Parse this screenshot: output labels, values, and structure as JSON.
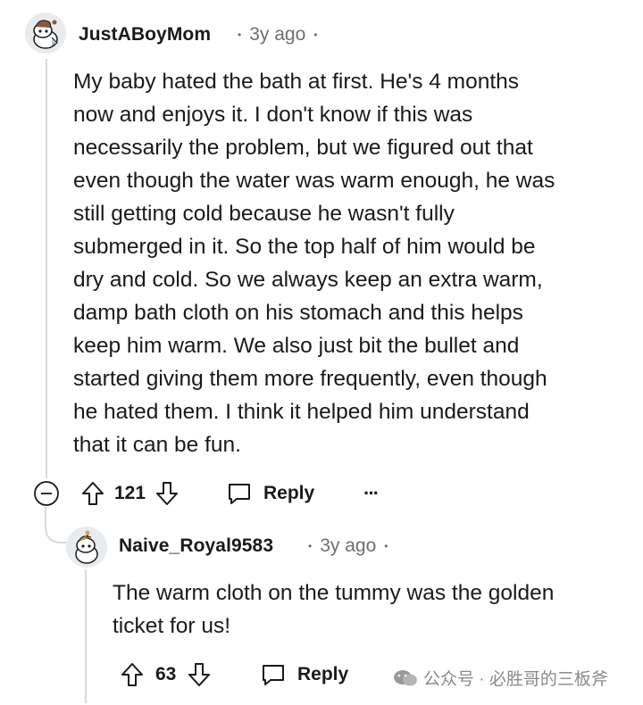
{
  "comments": [
    {
      "username": "JustABoyMom",
      "age": "3y ago",
      "body": "My baby hated the bath at first. He's 4 months\nnow and enjoys it. I don't know if this was\nnecessarily the problem, but we figured out that\neven though the water was warm enough, he was\nstill getting cold because he wasn't fully\nsubmerged in it. So the top half of him would be\ndry and cold. So we always keep an extra warm,\ndamp bath cloth on his stomach and this helps\nkeep him warm. We also just bit the bullet and\nstarted giving them more frequently, even though\nhe hated them. I think it helped him understand\nthat it can be fun.",
      "votes": "121",
      "reply_label": "Reply",
      "more_label": "···"
    },
    {
      "username": "Naive_Royal9583",
      "age": "3y ago",
      "body": "The warm cloth on the tummy was the golden\nticket for us!",
      "votes": "63",
      "reply_label": "Reply"
    }
  ],
  "separator_dot": "•",
  "watermark": "公众号 · 必胜哥的三板斧",
  "icons": {
    "collapse": "minus-circle-icon",
    "upvote": "arrow-up-icon",
    "downvote": "arrow-down-icon",
    "reply": "speech-bubble-icon",
    "watermark": "wechat-icon"
  }
}
